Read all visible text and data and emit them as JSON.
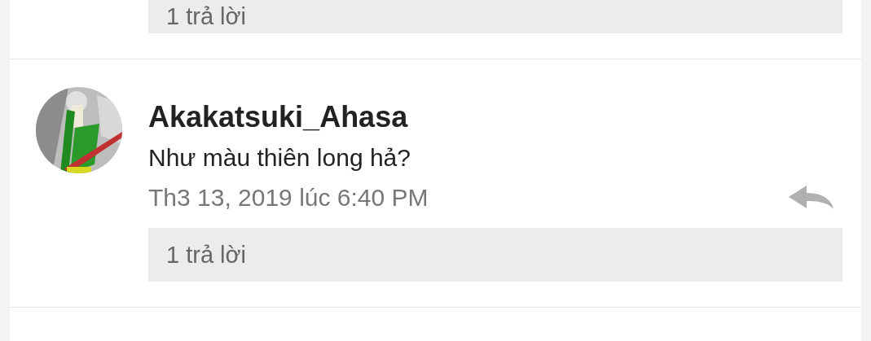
{
  "previous_comment": {
    "replies": "1 trả lời"
  },
  "comment": {
    "author": "Akakatsuki_Ahasa",
    "text": "Như màu thiên long hả?",
    "date": "Th3 13, 2019 lúc 6:40 PM",
    "replies": "1 trả lời"
  }
}
